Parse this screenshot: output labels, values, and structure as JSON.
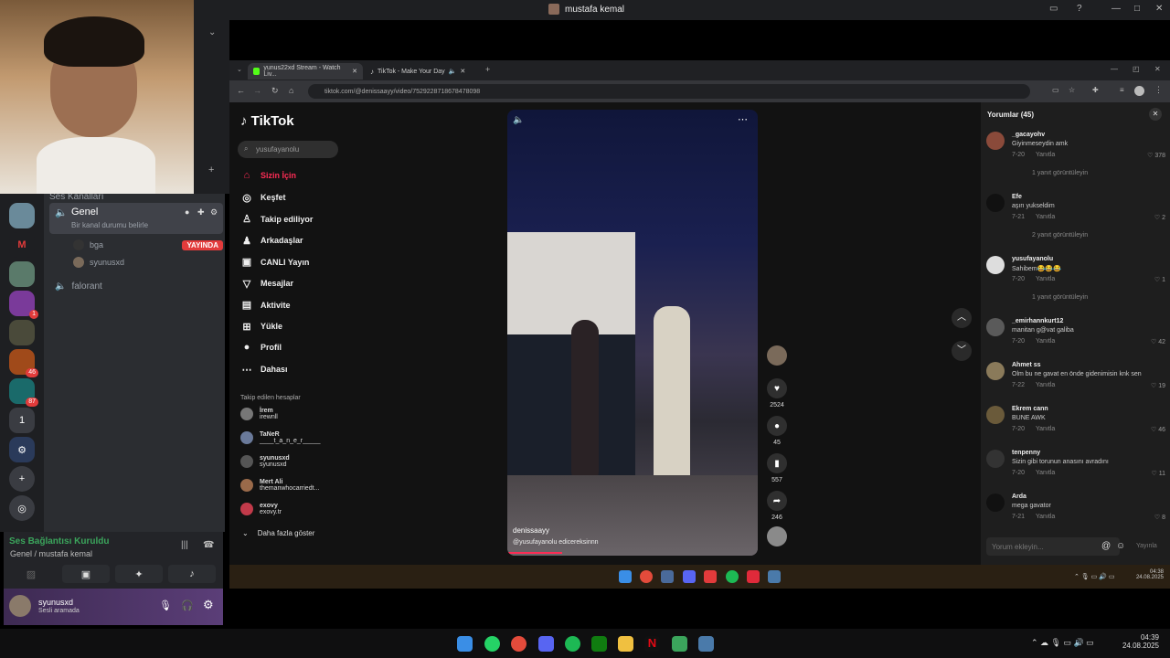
{
  "window": {
    "title": "mustafa kemal"
  },
  "discord": {
    "servers": [
      {
        "icon": "server-avatar-1",
        "badge": ""
      },
      {
        "icon": "server-m-logo",
        "badge": ""
      },
      {
        "icon": "server-avatar-3",
        "badge": ""
      },
      {
        "icon": "server-purple",
        "badge": "1"
      },
      {
        "icon": "server-avatar-5",
        "badge": ""
      },
      {
        "icon": "server-orange",
        "badge": "46"
      },
      {
        "icon": "server-teal",
        "badge": "87"
      },
      {
        "icon": "server-number",
        "label": "1"
      },
      {
        "icon": "server-gear",
        "badge": ""
      }
    ],
    "category": "Ses Kanalları",
    "channels": {
      "selected": {
        "name": "Genel",
        "status": "Bir kanal durumu belirle"
      },
      "members": [
        {
          "name": "bga",
          "live": "YAYINDA"
        },
        {
          "name": "syunusxd"
        }
      ],
      "other": "falorant"
    },
    "voice": {
      "status": "Ses Bağlantısı Kuruldu",
      "location": "Genel / mustafa kemal"
    },
    "user": {
      "name": "syunusxd",
      "status": "Sesli aramada"
    }
  },
  "browser": {
    "tabs": [
      {
        "label": "yunus22xd Stream - Watch Liv...",
        "active": true
      },
      {
        "label": "TikTok - Make Your Day",
        "active": false
      }
    ],
    "url": "tiktok.com/@denissaayy/video/7529228718678478098"
  },
  "tiktok": {
    "logo": "TikTok",
    "search_placeholder": "yusufayanolu",
    "nav": [
      {
        "label": "Sizin İçin",
        "icon": "home-icon",
        "active": true
      },
      {
        "label": "Keşfet",
        "icon": "compass-icon"
      },
      {
        "label": "Takip ediliyor",
        "icon": "following-icon"
      },
      {
        "label": "Arkadaşlar",
        "icon": "friends-icon"
      },
      {
        "label": "CANLI Yayın",
        "icon": "live-icon"
      },
      {
        "label": "Mesajlar",
        "icon": "messages-icon"
      },
      {
        "label": "Aktivite",
        "icon": "activity-icon"
      },
      {
        "label": "Yükle",
        "icon": "upload-icon"
      },
      {
        "label": "Profil",
        "icon": "profile-icon"
      },
      {
        "label": "Dahası",
        "icon": "more-icon"
      }
    ],
    "following_title": "Takip edilen hesaplar",
    "following": [
      {
        "name": "İrem",
        "handle": "irewnll"
      },
      {
        "name": "TaNeR",
        "handle": "____t_a_n_e_r_____"
      },
      {
        "name": "syunusxd",
        "handle": "syunusxd"
      },
      {
        "name": "Mert Ali",
        "handle": "themanwhocarriedt..."
      },
      {
        "name": "exovy",
        "handle": "exovy.tr"
      }
    ],
    "show_more": "Daha fazla göster",
    "video": {
      "author": "denissaayy",
      "caption": "@yusufayanolu edicereksinnn",
      "likes": "2524",
      "comments": "45",
      "saves": "557",
      "shares": "246"
    },
    "comments_title": "Yorumlar (45)",
    "comments": [
      {
        "user": "_gacayohv",
        "text": "Giyinmeseydin amk",
        "time": "7-20",
        "reply": "Yanıtla",
        "likes": "378",
        "more": "1 yanıt görüntüleyin"
      },
      {
        "user": "Efe",
        "text": "aşırı yukseldim",
        "time": "7-21",
        "reply": "Yanıtla",
        "likes": "2",
        "more": "2 yanıt görüntüleyin"
      },
      {
        "user": "yusufayanolu",
        "text": "Sahibem😂😂😂",
        "time": "7-20",
        "reply": "Yanıtla",
        "likes": "1",
        "more": "1 yanıt görüntüleyin"
      },
      {
        "user": "_emirhannkurt12",
        "text": "manitan g@vat galiba",
        "time": "7-20",
        "reply": "Yanıtla",
        "likes": "42",
        "more": ""
      },
      {
        "user": "Ahmet ss",
        "text": "Olm bu ne gavat en önde gidenimisin knk sen",
        "time": "7-22",
        "reply": "Yanıtla",
        "likes": "19",
        "more": ""
      },
      {
        "user": "Ekrem cann",
        "text": "BUNE AWK",
        "time": "7-20",
        "reply": "Yanıtla",
        "likes": "46",
        "more": ""
      },
      {
        "user": "tenpenny",
        "text": "Sizin gibi torunun anasını avradını",
        "time": "7-20",
        "reply": "Yanıtla",
        "likes": "11",
        "more": ""
      },
      {
        "user": "Arda",
        "text": "mega gavator",
        "time": "7-21",
        "reply": "Yanıtla",
        "likes": "8",
        "more": ""
      }
    ],
    "comment_placeholder": "Yorum ekleyin...",
    "post": "Yayınla"
  },
  "inner_taskbar": {
    "time": "04:38",
    "date": "24.08.2025"
  },
  "taskbar": {
    "time": "04:39",
    "date": "24.08.2025"
  }
}
